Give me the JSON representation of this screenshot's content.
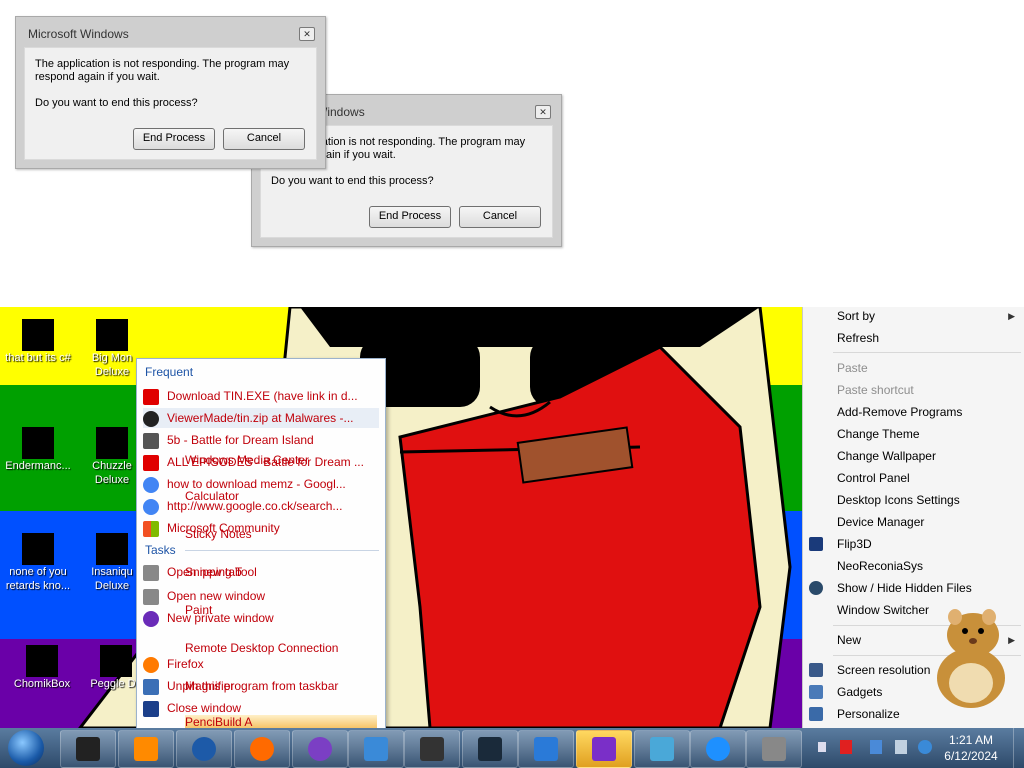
{
  "dialogs": [
    {
      "title": "Microsoft Windows",
      "message": "The application is not responding. The program may respond again if you wait.",
      "question": "Do you want to end this process?",
      "end_label": "End Process",
      "cancel_label": "Cancel"
    },
    {
      "title": "Microsoft Windows",
      "message": "The application is not responding. The program may respond again if you wait.",
      "question": "Do you want to end this process?",
      "end_label": "End Process",
      "cancel_label": "Cancel"
    }
  ],
  "desktop": {
    "stripe_colors": [
      "#ffff00",
      "#00a000",
      "#0050ff",
      "#6a00a8"
    ],
    "icons": [
      {
        "label": "that but its c#"
      },
      {
        "label": "Big Mon Deluxe"
      },
      {
        "label": "Endermanc..."
      },
      {
        "label": "Chuzzle Deluxe"
      },
      {
        "label": "none of you retards kno..."
      },
      {
        "label": "Insaniqu Deluxe"
      },
      {
        "label": "ChomikBox"
      },
      {
        "label": "Peggle De"
      }
    ]
  },
  "jumplist": {
    "frequent_header": "Frequent",
    "frequent": [
      {
        "label": "Download TIN.EXE (have link in d...",
        "icon": "youtube-icon",
        "color": "#e00000"
      },
      {
        "label": "ViewerMade/tin.zip at Malwares -...",
        "icon": "github-icon",
        "color": "#222222"
      },
      {
        "label": "5b - Battle for Dream Island",
        "icon": "page-icon",
        "color": "#555555"
      },
      {
        "label": "ALL EPISODES - Battle for Dream ...",
        "icon": "youtube-icon",
        "color": "#e00000"
      },
      {
        "label": "how to download memz - Googl...",
        "icon": "google-icon",
        "color": "#4285f4"
      },
      {
        "label": "http://www.google.co.ck/search...",
        "icon": "google-icon",
        "color": "#4285f4"
      },
      {
        "label": "Microsoft Community",
        "icon": "windows-icon",
        "color": "#f25022"
      }
    ],
    "tasks_header": "Tasks",
    "tasks": [
      {
        "label": "Open new tab",
        "icon": "new-tab-icon",
        "color": "#888888"
      },
      {
        "label": "Open new window",
        "icon": "new-window-icon",
        "color": "#888888"
      },
      {
        "label": "New private window",
        "icon": "private-icon",
        "color": "#6a2bb8"
      },
      {
        "label": "Firefox",
        "icon": "firefox-icon",
        "color": "#ff7a00"
      },
      {
        "label": "Unpin this program from taskbar",
        "icon": "unpin-icon",
        "color": "#3b6fb6"
      },
      {
        "label": "Close window",
        "icon": "close-icon",
        "color": "#1b3f8a"
      }
    ],
    "overlapping": [
      "Windows Media Center",
      "Calculator",
      "Sticky Notes",
      "Snipping Tool",
      "Paint",
      "Remote Desktop Connection",
      "Magnifier",
      "PenciBuild A"
    ]
  },
  "context_menu": {
    "items": [
      {
        "label": "Sort by",
        "submenu": true,
        "disabled": false
      },
      {
        "label": "Refresh",
        "submenu": false,
        "disabled": false
      },
      {
        "label": "Paste",
        "submenu": false,
        "disabled": true
      },
      {
        "label": "Paste shortcut",
        "submenu": false,
        "disabled": true
      },
      {
        "label": "Add-Remove Programs",
        "submenu": false,
        "disabled": false
      },
      {
        "label": "Change Theme",
        "submenu": false,
        "disabled": false
      },
      {
        "label": "Change Wallpaper",
        "submenu": false,
        "disabled": false
      },
      {
        "label": "Control Panel",
        "submenu": false,
        "disabled": false
      },
      {
        "label": "Desktop Icons Settings",
        "submenu": false,
        "disabled": false
      },
      {
        "label": "Device Manager",
        "submenu": false,
        "disabled": false
      },
      {
        "label": "Flip3D",
        "submenu": false,
        "disabled": false
      },
      {
        "label": "NeoReconiaSys",
        "submenu": false,
        "disabled": false
      },
      {
        "label": "Show / Hide Hidden Files",
        "submenu": false,
        "disabled": false
      },
      {
        "label": "Window Switcher",
        "submenu": false,
        "disabled": false
      },
      {
        "label": "New",
        "submenu": true,
        "disabled": false
      },
      {
        "label": "Screen resolution",
        "submenu": false,
        "disabled": false
      },
      {
        "label": "Gadgets",
        "submenu": false,
        "disabled": false
      },
      {
        "label": "Personalize",
        "submenu": false,
        "disabled": false
      }
    ]
  },
  "taskbar": {
    "start_icon": "windows-orb-icon",
    "buttons": [
      {
        "icon": "monitor-icon",
        "color": "#222222"
      },
      {
        "icon": "media-player-icon",
        "color": "#ff8a00"
      },
      {
        "icon": "globe-icon",
        "color": "#1d5aa8"
      },
      {
        "icon": "firefox-icon",
        "color": "#ff6a00"
      },
      {
        "icon": "bonzi-icon",
        "color": "#7b3fc4"
      },
      {
        "icon": "photo-icon",
        "color": "#3a8ad8"
      },
      {
        "icon": "terminal-icon",
        "color": "#333333"
      },
      {
        "icon": "task-manager-icon",
        "color": "#1a2a3a"
      },
      {
        "icon": "window-icon",
        "color": "#2a7ad8"
      },
      {
        "icon": "visual-studio-icon",
        "color": "#7a2fc8"
      },
      {
        "icon": "notes-icon",
        "color": "#4aa8d8"
      },
      {
        "icon": "internet-explorer-icon",
        "color": "#1e90ff"
      },
      {
        "icon": "disk-icon",
        "color": "#888888"
      }
    ],
    "clock": {
      "time": "1:21 AM",
      "date": "6/12/2024"
    }
  }
}
